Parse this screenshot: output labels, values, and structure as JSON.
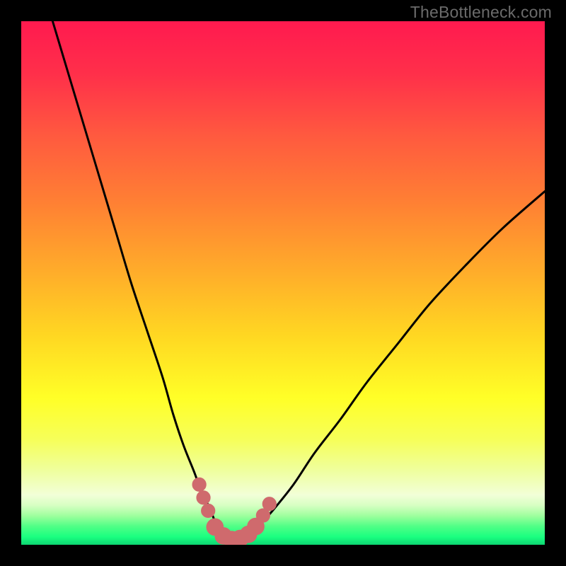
{
  "watermark": "TheBottleneck.com",
  "colors": {
    "frame": "#000000",
    "curve_stroke": "#000000",
    "marker_fill": "#cf6a6d",
    "marker_stroke": "#cf6a6d",
    "gradient_stops": [
      {
        "offset": 0.0,
        "color": "#ff1a4f"
      },
      {
        "offset": 0.1,
        "color": "#ff2f4a"
      },
      {
        "offset": 0.22,
        "color": "#ff5a3f"
      },
      {
        "offset": 0.35,
        "color": "#ff8133"
      },
      {
        "offset": 0.48,
        "color": "#ffad2a"
      },
      {
        "offset": 0.6,
        "color": "#ffd722"
      },
      {
        "offset": 0.72,
        "color": "#ffff27"
      },
      {
        "offset": 0.8,
        "color": "#f6ff5a"
      },
      {
        "offset": 0.86,
        "color": "#efffa0"
      },
      {
        "offset": 0.905,
        "color": "#f2ffd8"
      },
      {
        "offset": 0.925,
        "color": "#d6ffc2"
      },
      {
        "offset": 0.945,
        "color": "#9dff9d"
      },
      {
        "offset": 0.965,
        "color": "#4fff86"
      },
      {
        "offset": 0.985,
        "color": "#1aff80"
      },
      {
        "offset": 1.0,
        "color": "#0dd672"
      }
    ]
  },
  "chart_data": {
    "type": "line",
    "title": "",
    "xlabel": "",
    "ylabel": "",
    "xlim": [
      0,
      100
    ],
    "ylim": [
      0,
      100
    ],
    "series": [
      {
        "name": "bottleneck-curve",
        "x": [
          6,
          9,
          12,
          15,
          18,
          21,
          24,
          27,
          29,
          31,
          33,
          34.5,
          36,
          37,
          38,
          39.5,
          41,
          43,
          45,
          48,
          52,
          56,
          61,
          66,
          72,
          78,
          85,
          92,
          100
        ],
        "y": [
          100,
          90,
          80,
          70,
          60,
          50,
          41,
          32,
          25,
          19,
          14,
          10,
          7,
          4.5,
          2.8,
          1.6,
          1.0,
          1.6,
          3.2,
          6.5,
          11.5,
          17.5,
          24,
          31,
          38.5,
          46,
          53.5,
          60.5,
          67.5
        ]
      }
    ],
    "markers": [
      {
        "x": 34.0,
        "y": 11.5,
        "r": 1.3
      },
      {
        "x": 34.8,
        "y": 9.0,
        "r": 1.3
      },
      {
        "x": 35.7,
        "y": 6.5,
        "r": 1.3
      },
      {
        "x": 37.0,
        "y": 3.4,
        "r": 1.6
      },
      {
        "x": 38.6,
        "y": 1.7,
        "r": 1.6
      },
      {
        "x": 40.2,
        "y": 1.0,
        "r": 1.6
      },
      {
        "x": 41.8,
        "y": 1.2,
        "r": 1.6
      },
      {
        "x": 43.4,
        "y": 2.0,
        "r": 1.6
      },
      {
        "x": 44.8,
        "y": 3.5,
        "r": 1.6
      },
      {
        "x": 46.2,
        "y": 5.6,
        "r": 1.3
      },
      {
        "x": 47.4,
        "y": 7.8,
        "r": 1.3
      }
    ]
  }
}
